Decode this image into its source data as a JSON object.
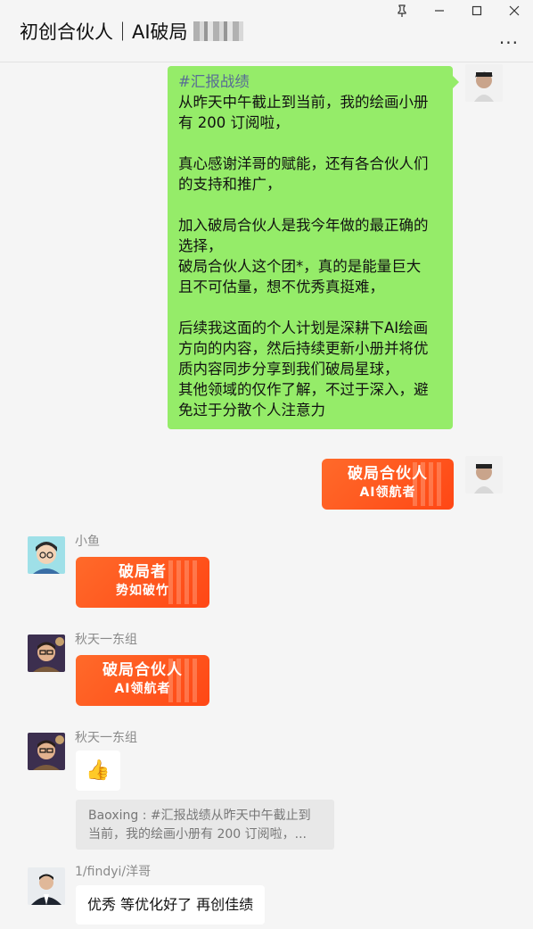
{
  "window": {
    "pin_icon": "pin-icon",
    "minimize_icon": "minimize-icon",
    "maximize_icon": "maximize-icon",
    "close_icon": "close-icon"
  },
  "header": {
    "title": "初创合伙人｜AI破局",
    "more_label": "..."
  },
  "messages": {
    "long_post": {
      "tag": "#汇报战绩",
      "lines": [
        "从昨天中午截止到当前，我的绘画小册",
        "有 200 订阅啦，",
        "真心感谢洋哥的赋能，还有各合伙人们",
        "的支持和推广，",
        "加入破局合伙人是我今年做的最正确的",
        "选择，",
        "破局合伙人这个团*，真的是能量巨大",
        "且不可估量，想不优秀真挺难，",
        "后续我这面的个人计划是深耕下AI绘画",
        "方向的内容，然后持续更新小册并将优",
        "质内容同步分享到我们破局星球，",
        "其他领域的仅作了解，不过于深入，避",
        "免过于分散个人注意力"
      ]
    },
    "my_sticker": {
      "line1": "破局合伙人",
      "line2": "AI领航者"
    },
    "m1": {
      "sender": "小鱼",
      "line1": "破局者",
      "line2": "势如破竹"
    },
    "m2": {
      "sender": "秋天一东组",
      "line1": "破局合伙人",
      "line2": "AI领航者"
    },
    "m3": {
      "sender": "秋天一东组",
      "emoji": "👍"
    },
    "m4": {
      "quote_line1": "Baoxing : #汇报战绩从昨天中午截止到",
      "quote_line2": "当前，我的绘画小册有 200 订阅啦，...",
      "sender": "1/findyi/洋哥",
      "text": "优秀 等优化好了 再创佳绩"
    }
  },
  "colors": {
    "self_bubble": "#95ec69",
    "sticker_orange": "#ff5a1f",
    "background": "#f5f5f5",
    "link_tag": "#576b95"
  }
}
